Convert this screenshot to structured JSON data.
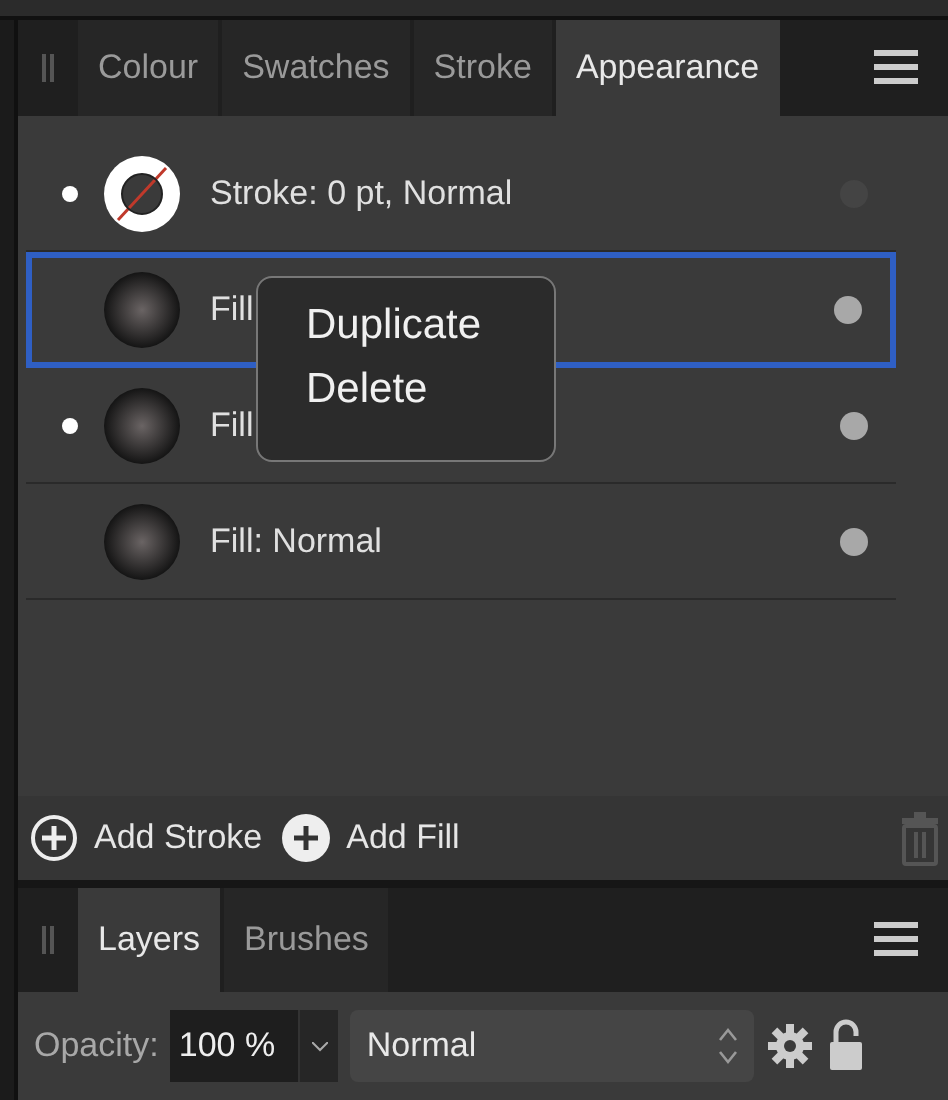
{
  "appearance_panel": {
    "tabs": [
      {
        "label": "Colour",
        "selected": false
      },
      {
        "label": "Swatches",
        "selected": false
      },
      {
        "label": "Stroke",
        "selected": false
      },
      {
        "label": "Appearance",
        "selected": true
      }
    ],
    "rows": [
      {
        "kind": "stroke",
        "label": "Stroke: 0 pt, Normal",
        "marked": true,
        "visible": false,
        "selected": false
      },
      {
        "kind": "fill",
        "label": "Fill",
        "marked": false,
        "visible": true,
        "selected": true
      },
      {
        "kind": "fill",
        "label": "Fill",
        "marked": true,
        "visible": true,
        "selected": false
      },
      {
        "kind": "fill",
        "label": "Fill: Normal",
        "marked": false,
        "visible": true,
        "selected": false
      }
    ],
    "context_menu": {
      "items": [
        "Duplicate",
        "Delete"
      ]
    },
    "footer": {
      "add_stroke": "Add Stroke",
      "add_fill": "Add Fill"
    }
  },
  "layers_panel": {
    "tabs": [
      {
        "label": "Layers",
        "selected": true
      },
      {
        "label": "Brushes",
        "selected": false
      }
    ],
    "opacity_label": "Opacity:",
    "opacity_value": "100 %",
    "blend_mode": "Normal"
  }
}
